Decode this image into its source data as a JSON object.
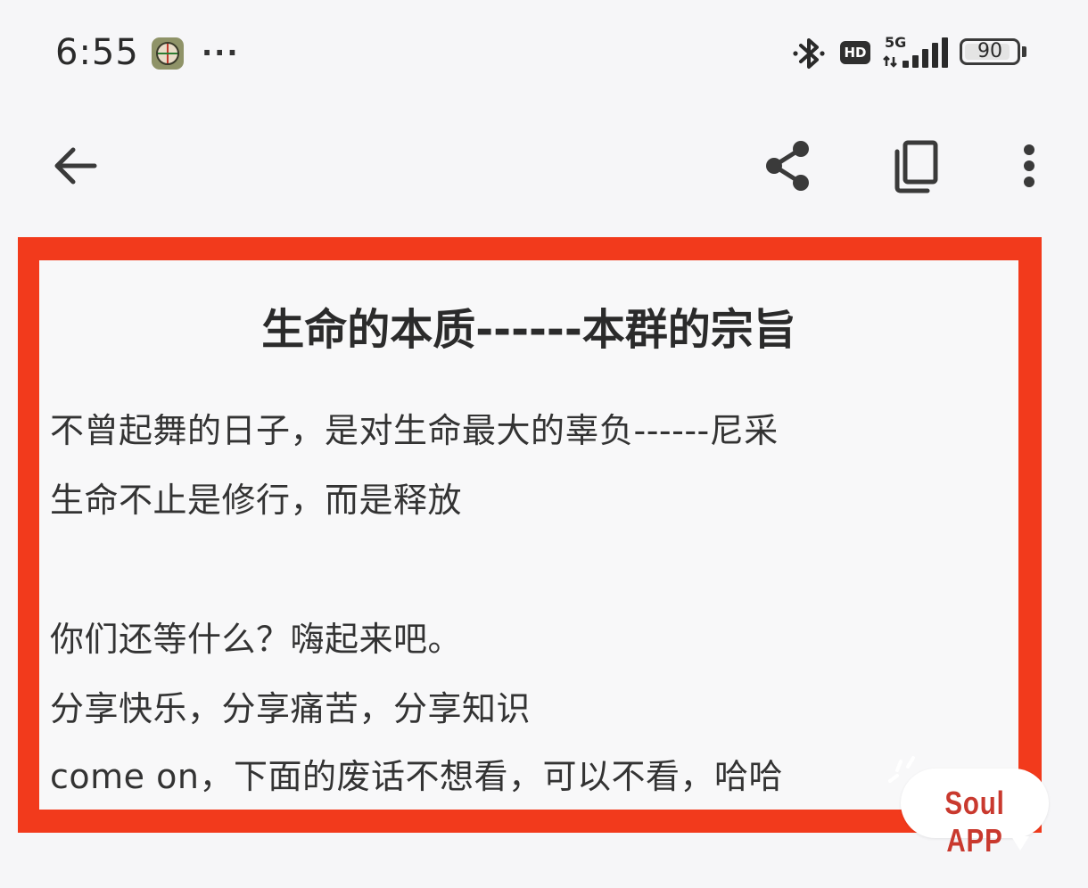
{
  "status_bar": {
    "time": "6:55",
    "more_notifications": "···",
    "network_type": "5G",
    "hd_label": "HD",
    "battery_level": "90",
    "battery_fraction": 0.9,
    "icons": [
      "app-notification-icon",
      "bluetooth-icon",
      "hd-icon",
      "signal-icon",
      "battery-icon"
    ]
  },
  "toolbar": {
    "icons": [
      "back-arrow-icon",
      "share-icon",
      "copy-icon",
      "more-vert-icon"
    ]
  },
  "document": {
    "title": "生命的本质------本群的宗旨",
    "lines": [
      "不曾起舞的日子，是对生命最大的辜负------尼采",
      "生命不止是修行，而是释放",
      "你们还等什么？嗨起来吧。",
      "分享快乐，分享痛苦，分享知识",
      "come on，下面的废话不想看，可以不看，哈哈"
    ],
    "frame_color": "#f23a1c"
  },
  "watermark": {
    "text": "Soul APP",
    "color": "#c9392e"
  }
}
